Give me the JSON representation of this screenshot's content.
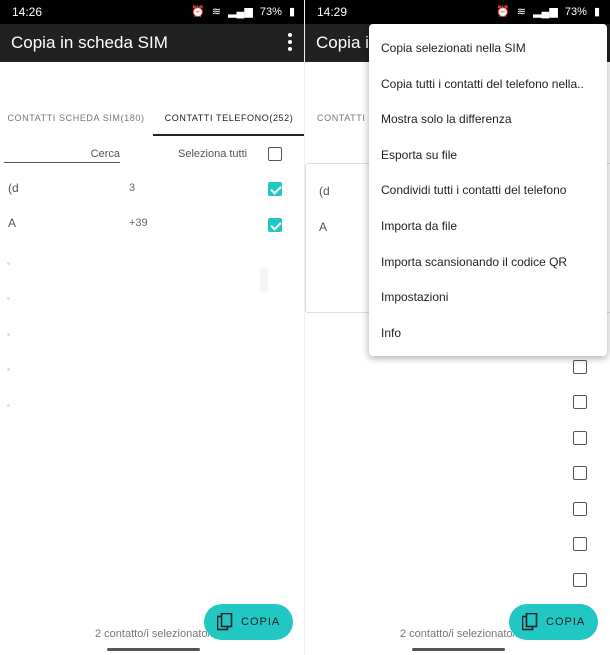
{
  "left": {
    "status_time": "14:26",
    "battery": "73%",
    "title": "Copia in scheda SIM",
    "tabs": [
      "CONTATTI SCHEDA SIM(180)",
      "CONTATTI TELEFONO(252)"
    ],
    "search_label": "Cerca",
    "select_all_label": "Seleziona tutti",
    "rows": [
      {
        "name": "(d",
        "number": "3",
        "checked": true
      },
      {
        "name": "A",
        "number": "+39",
        "checked": true
      }
    ],
    "fab_label": "COPIA",
    "footer": "2 contatto/i selezionato/i"
  },
  "right": {
    "status_time": "14:29",
    "battery": "73%",
    "title": "Copia in",
    "tab_partial": "CONTATTI S",
    "row_names": [
      "(d",
      "A"
    ],
    "menu": [
      "Copia selezionati nella SIM",
      "Copia tutti i contatti del telefono nella..",
      "Mostra solo la differenza",
      "Esporta su file",
      "Condividi tutti i contatti del telefono",
      "Importa da file",
      "Importa scansionando il codice QR",
      "Impostazioni",
      "Info"
    ],
    "fab_label": "COPIA",
    "footer": "2 contatto/i selezionato/i"
  },
  "colors": {
    "accent": "#21c7c3",
    "appbar": "#212121"
  }
}
